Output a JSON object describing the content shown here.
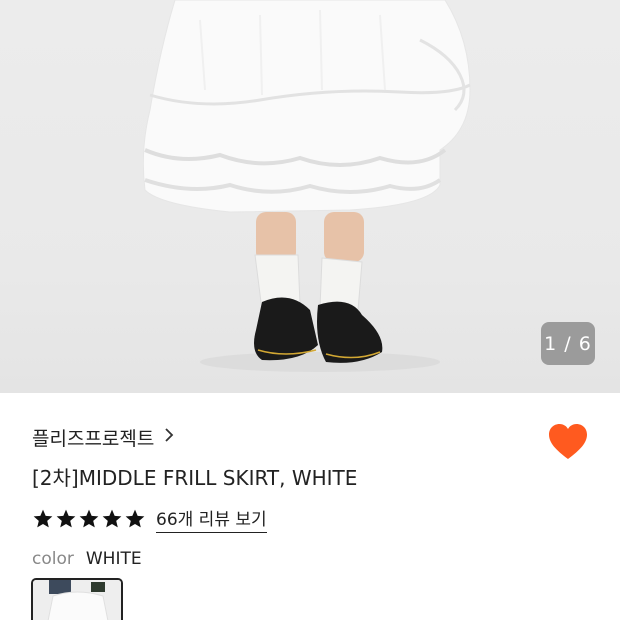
{
  "gallery": {
    "current_page": "1",
    "total_pages": "6",
    "indicator": "1 / 6",
    "image_alt": "white frill skirt product photo"
  },
  "product": {
    "brand": "플리즈프로젝트",
    "brand_chevron_icon": "chevron-right-icon",
    "title": "[2차]MIDDLE FRILL SKIRT, WHITE",
    "rating_stars": 5,
    "review_link": "66개 리뷰 보기",
    "favorite_icon": "heart-icon",
    "favorite_color": "#ff5a1f"
  },
  "options": {
    "color_label": "color",
    "color_value": "WHITE"
  }
}
